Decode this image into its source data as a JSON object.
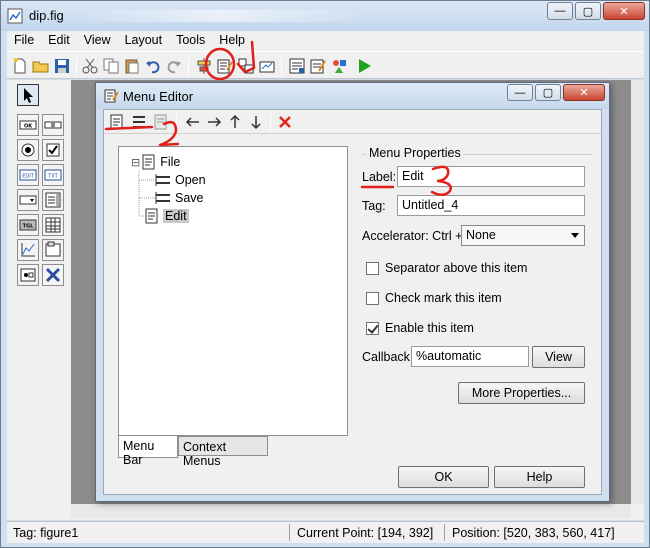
{
  "window": {
    "title": "dip.fig",
    "minimize": "—",
    "maximize": "▢",
    "close": "✕"
  },
  "menubar": [
    "File",
    "Edit",
    "View",
    "Layout",
    "Tools",
    "Help"
  ],
  "toolbar_icons": [
    "new-file-icon",
    "open-folder-icon",
    "save-icon",
    "cut-icon",
    "copy-icon",
    "paste-icon",
    "undo-icon",
    "redo-icon",
    "align-objects-icon",
    "menu-editor-icon",
    "tab-order-editor-icon",
    "toolbar-editor-icon",
    "mfile-editor-icon",
    "property-inspector-icon",
    "object-browser-icon",
    "run-figure-icon"
  ],
  "palette": [
    {
      "name": "select-tool",
      "glyph": "↖"
    },
    {
      "name": "push-button",
      "glyph": "OK"
    },
    {
      "name": "slider",
      "glyph": "═"
    },
    {
      "name": "radio-button",
      "glyph": "◉"
    },
    {
      "name": "check-box",
      "glyph": "☑"
    },
    {
      "name": "edit-text",
      "glyph": "EDIT"
    },
    {
      "name": "static-text",
      "glyph": "TXT"
    },
    {
      "name": "pop-up-menu",
      "glyph": "▭"
    },
    {
      "name": "list-box",
      "glyph": "☰"
    },
    {
      "name": "toggle-button",
      "glyph": "TGL"
    },
    {
      "name": "table",
      "glyph": "▦"
    },
    {
      "name": "axes",
      "glyph": "⟋"
    },
    {
      "name": "panel",
      "glyph": "▣"
    },
    {
      "name": "button-group",
      "glyph": "▤"
    },
    {
      "name": "activex-control",
      "glyph": "✕"
    }
  ],
  "status": {
    "tag": "Tag: figure1",
    "current_point": "Current Point:  [194, 392]",
    "position": "Position: [520, 383, 560, 417]"
  },
  "dialog": {
    "title": "Menu Editor",
    "tree": [
      {
        "label": "File",
        "level": 0,
        "expander": "⊟"
      },
      {
        "label": "Open",
        "level": 1
      },
      {
        "label": "Save",
        "level": 1
      },
      {
        "label": "Edit",
        "level": 0,
        "selected": true
      }
    ],
    "tabs": {
      "menu_bar": "Menu Bar",
      "context_menus": "Context Menus"
    },
    "props": {
      "group_title": "Menu Properties",
      "label_caption": "Label:",
      "label_value": "Edit",
      "tag_caption": "Tag:",
      "tag_value": "Untitled_4",
      "accel_caption": "Accelerator: Ctrl +",
      "accel_value": "None",
      "separator": "Separator above this item",
      "separator_checked": false,
      "check_mark": "Check mark this item",
      "check_mark_checked": false,
      "enable": "Enable this item",
      "enable_checked": true,
      "callback_caption": "Callback:",
      "callback_value": "%automatic",
      "view_button": "View",
      "more_button": "More Properties..."
    },
    "ok_button": "OK",
    "help_button": "Help"
  },
  "annotation_color": "#e2201b"
}
